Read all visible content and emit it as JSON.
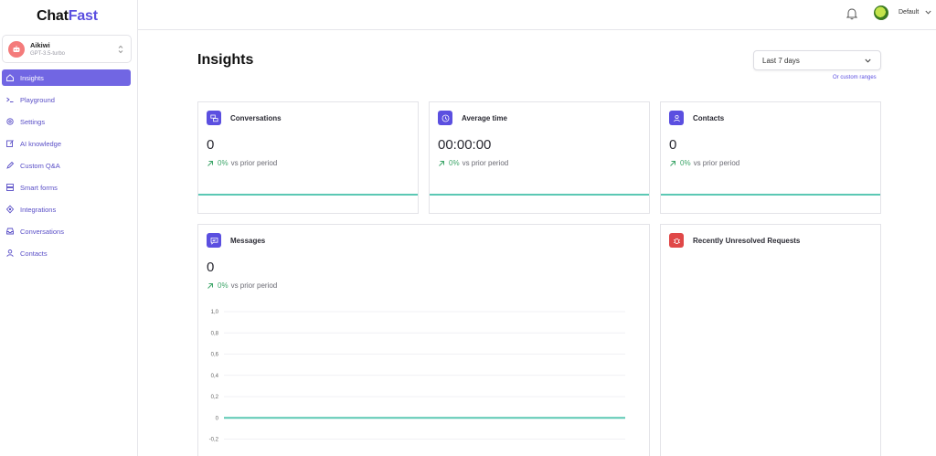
{
  "brand": {
    "part1": "Chat",
    "part2": "Fast"
  },
  "bot": {
    "name": "Aikiwi",
    "model": "GPT-3.5-turbo"
  },
  "sidebar": {
    "items": [
      {
        "label": "Insights",
        "icon": "home-icon",
        "active": true
      },
      {
        "label": "Playground",
        "icon": "terminal-icon"
      },
      {
        "label": "Settings",
        "icon": "gear-icon"
      },
      {
        "label": "AI knowledge",
        "icon": "edit-icon"
      },
      {
        "label": "Custom Q&A",
        "icon": "pen-icon"
      },
      {
        "label": "Smart forms",
        "icon": "forms-icon"
      },
      {
        "label": "Integrations",
        "icon": "integrations-icon"
      },
      {
        "label": "Conversations",
        "icon": "inbox-icon"
      },
      {
        "label": "Contacts",
        "icon": "user-icon"
      }
    ]
  },
  "topbar": {
    "workspace": "Default"
  },
  "page": {
    "title": "Insights",
    "range": "Last 7 days",
    "custom_range": "Or custom ranges"
  },
  "cards": {
    "conversations": {
      "title": "Conversations",
      "value": "0",
      "pct": "0%",
      "suffix": "vs prior period"
    },
    "average_time": {
      "title": "Average time",
      "value": "00:00:00",
      "pct": "0%",
      "suffix": "vs prior period"
    },
    "contacts": {
      "title": "Contacts",
      "value": "0",
      "pct": "0%",
      "suffix": "vs prior period"
    },
    "messages": {
      "title": "Messages",
      "value": "0",
      "pct": "0%",
      "suffix": "vs prior period"
    },
    "unresolved": {
      "title": "Recently Unresolved Requests"
    }
  },
  "colors": {
    "accent": "#5b4fe0",
    "accent_light": "#7166e3",
    "positive": "#3fa66a",
    "series": "#5bc8b4",
    "danger": "#e04848"
  },
  "chart_data": {
    "type": "line",
    "title": "",
    "xlabel": "",
    "ylabel": "",
    "y_ticks": [
      "1,0",
      "0,8",
      "0,6",
      "0,4",
      "0,2",
      "0",
      "-0,2"
    ],
    "ylim": [
      -0.2,
      1.0
    ],
    "grid": true,
    "series": [
      {
        "values": [
          0,
          0,
          0,
          0,
          0,
          0,
          0
        ]
      }
    ]
  }
}
